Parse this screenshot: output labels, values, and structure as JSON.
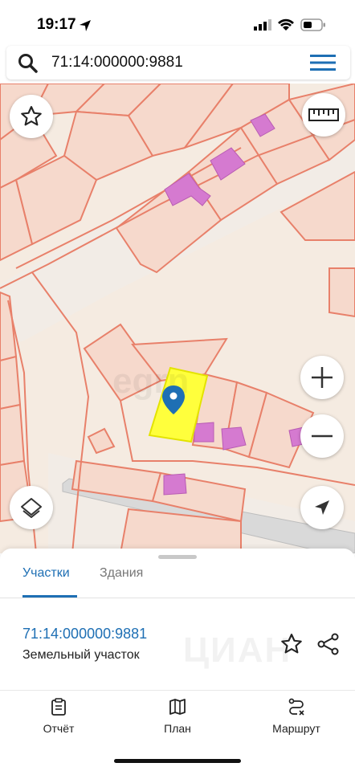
{
  "status_bar": {
    "time": "19:17"
  },
  "search": {
    "value": "71:14:000000:9881"
  },
  "map": {
    "watermark": "egrn",
    "colors": {
      "background": "#f5ebe1",
      "parcel_line": "#e8806a",
      "parcel_fill": "#f6d9cc",
      "building": "#d57ad0",
      "selected_parcel": "#ffff3c",
      "road": "#d9d9d9",
      "pin": "#1e6fb4"
    }
  },
  "tabs": {
    "active": "Участки",
    "inactive": "Здания"
  },
  "result": {
    "number": "71:14:000000:9881",
    "type": "Земельный участок",
    "watermark": "ЦИАН"
  },
  "bottom_nav": {
    "report": "Отчёт",
    "plan": "План",
    "route": "Маршрут"
  },
  "icons": {
    "search": "search-icon",
    "menu": "menu-icon",
    "favorite": "star-icon",
    "ruler": "ruler-icon",
    "zoom_in": "plus-icon",
    "zoom_out": "minus-icon",
    "layers": "layers-icon",
    "locate": "navigation-arrow-icon",
    "pin": "map-pin-icon",
    "share": "share-icon",
    "report": "clipboard-icon",
    "plan": "map-icon",
    "route": "route-icon"
  }
}
